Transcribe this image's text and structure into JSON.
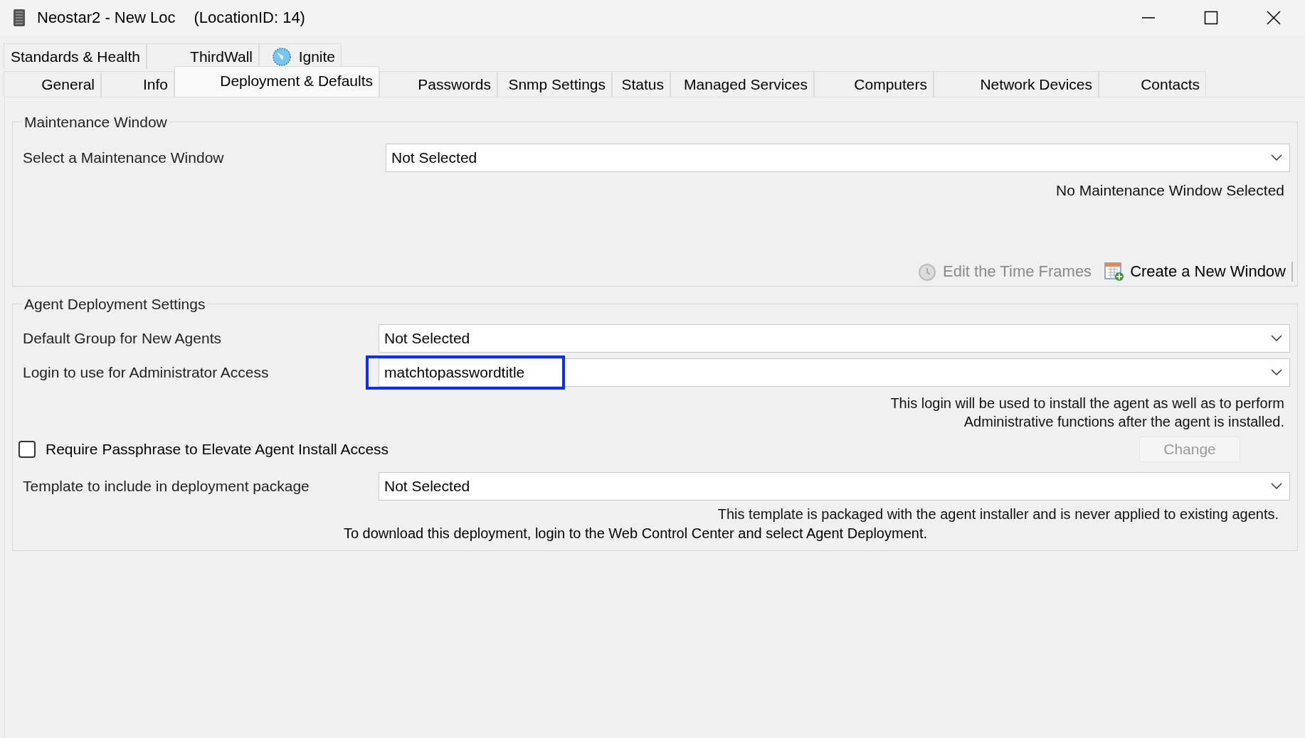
{
  "window": {
    "title": "Neostar2 - New Loc",
    "subtitle": "(LocationID: 14)"
  },
  "tab_rows": [
    {
      "tabs": [
        {
          "label": "Standards & Health",
          "selected": false,
          "icon": false
        },
        {
          "label": "ThirdWall",
          "selected": false,
          "icon": false
        },
        {
          "label": "Ignite",
          "selected": false,
          "icon": true
        }
      ]
    },
    {
      "tabs": [
        {
          "label": "General",
          "selected": false,
          "icon": false
        },
        {
          "label": "Info",
          "selected": false,
          "icon": false
        },
        {
          "label": "Deployment & Defaults",
          "selected": true,
          "icon": false
        },
        {
          "label": "Passwords",
          "selected": false,
          "icon": false
        },
        {
          "label": "Snmp Settings",
          "selected": false,
          "icon": false
        },
        {
          "label": "Status",
          "selected": false,
          "icon": false
        },
        {
          "label": "Managed Services",
          "selected": false,
          "icon": false
        },
        {
          "label": "Computers",
          "selected": false,
          "icon": false
        },
        {
          "label": "Network Devices",
          "selected": false,
          "icon": false
        },
        {
          "label": "Contacts",
          "selected": false,
          "icon": false
        }
      ]
    }
  ],
  "maintenance_window": {
    "title": "Maintenance Window",
    "label": "Select a Maintenance Window",
    "value": "Not Selected",
    "status": "No Maintenance Window Selected",
    "actions": [
      {
        "label": "Edit the Time Frames",
        "kind": "clock",
        "disabled": true
      },
      {
        "label": "Create a New Window",
        "kind": "calendar",
        "disabled": false
      }
    ]
  },
  "agent_deployment": {
    "title": "Agent Deployment Settings",
    "default_group": {
      "label": "Default Group for New Agents",
      "value": "Not Selected",
      "highlighted": false
    },
    "login": {
      "label": "Login to use for Administrator Access",
      "value": "matchtopasswordtitle",
      "highlighted": true
    },
    "login_help": [
      "This login will be used to install the agent as well as to perform",
      "Administrative functions after the agent is installed."
    ],
    "passphrase": {
      "label": "Require Passphrase to Elevate Agent Install Access",
      "checked": false
    },
    "change_button": {
      "label": "Change",
      "disabled": true
    },
    "template": {
      "label": "Template to include in deployment package",
      "value": "Not Selected",
      "highlighted": false
    },
    "template_help": "This template is packaged with the agent installer and is never applied to existing agents.",
    "download_note": "To download this deployment, login to the Web Control Center and select Agent Deployment."
  }
}
